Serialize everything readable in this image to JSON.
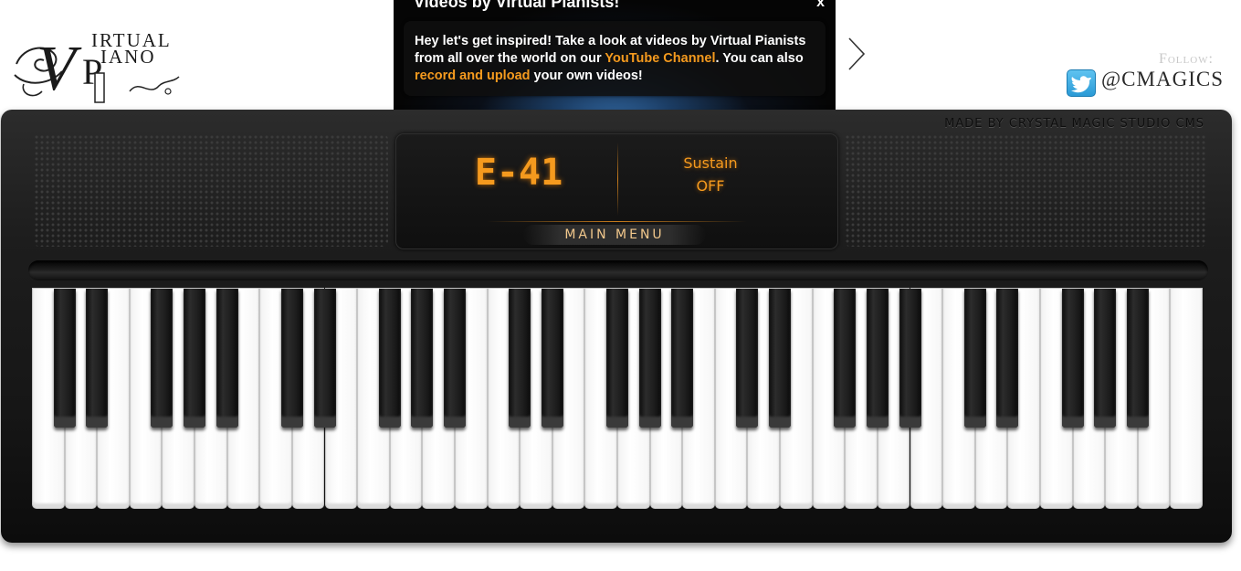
{
  "logo": {
    "line1": "IRTUAL",
    "line2": "IANO",
    "initial_v": "V",
    "initial_p": "P"
  },
  "notice": {
    "title": "Videos by Virtual Pianists!",
    "close_label": "x",
    "text_1": "Hey let's get inspired! Take a look at videos by Virtual Pianists from all over the world on our ",
    "link_1": "YouTube Channel",
    "text_2": ". You can also ",
    "link_2": "record and upload",
    "text_3": " your own videos!"
  },
  "follow": {
    "label": "Follow:",
    "handle": "@CMAGICS",
    "icon": "twitter-icon"
  },
  "piano": {
    "brand": "MADE BY CRYSTAL MAGIC STUDIO  CMS",
    "display": {
      "note": "E-41",
      "sustain_label": "Sustain",
      "sustain_value": "OFF",
      "main_menu": "MAIN MENU"
    },
    "white_key_count": 36,
    "black_key_pattern": "2-3 groups"
  },
  "colors": {
    "accent": "#f59a1e",
    "piano_body": "#1d1d1d",
    "link": "#f59a1e"
  }
}
